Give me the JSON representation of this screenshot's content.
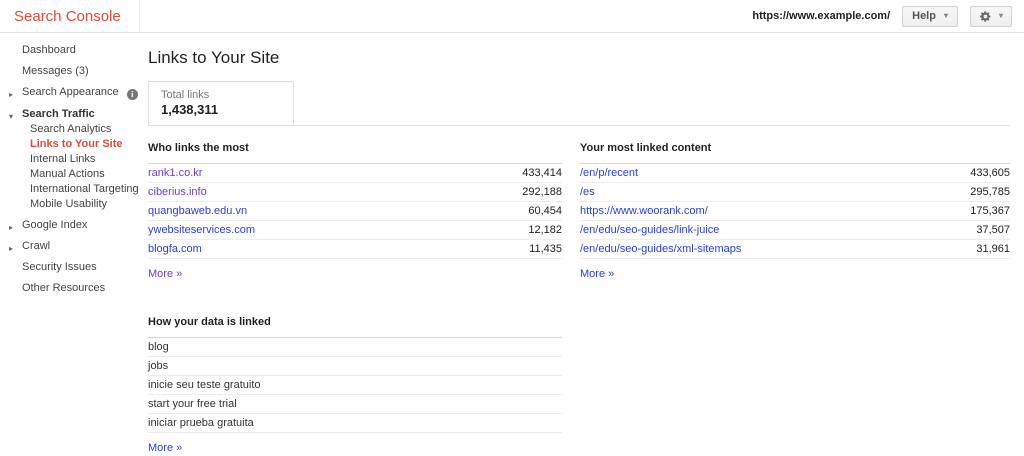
{
  "header": {
    "logo": "Search Console",
    "site_url": "https://www.example.com/",
    "help_label": "Help"
  },
  "icons": {
    "dropdown": "▾",
    "collapsed": "▸",
    "expanded": "▾",
    "info": "i"
  },
  "sidebar": {
    "items": [
      {
        "label": "Dashboard"
      },
      {
        "label": "Messages (3)"
      },
      {
        "label": "Search Appearance",
        "state": "collapsed",
        "has_info": true
      },
      {
        "label": "Search Traffic",
        "state": "expanded"
      },
      {
        "label": "Search Analytics",
        "level": "sub"
      },
      {
        "label": "Links to Your Site",
        "level": "sub",
        "selected": true
      },
      {
        "label": "Internal Links",
        "level": "sub"
      },
      {
        "label": "Manual Actions",
        "level": "sub"
      },
      {
        "label": "International Targeting",
        "level": "sub"
      },
      {
        "label": "Mobile Usability",
        "level": "sub"
      },
      {
        "label": "Google Index",
        "state": "collapsed"
      },
      {
        "label": "Crawl",
        "state": "collapsed"
      },
      {
        "label": "Security Issues"
      },
      {
        "label": "Other Resources"
      }
    ]
  },
  "main": {
    "title": "Links to Your Site",
    "total_links": {
      "label": "Total links",
      "value": "1,438,311"
    },
    "tables": {
      "who_links": {
        "header": "Who links the most",
        "rows": [
          {
            "link": "rank1.co.kr",
            "value": "433,414",
            "visited": true
          },
          {
            "link": "ciberius.info",
            "value": "292,188",
            "visited": true
          },
          {
            "link": "quangbaweb.edu.vn",
            "value": "60,454",
            "visited": false
          },
          {
            "link": "ywebsiteservices.com",
            "value": "12,182",
            "visited": false
          },
          {
            "link": "blogfa.com",
            "value": "11,435",
            "visited": false
          }
        ],
        "more_label": "More »"
      },
      "linked_content": {
        "header": "Your most linked content",
        "rows": [
          {
            "link": "/en/p/recent",
            "value": "433,605",
            "visited": false
          },
          {
            "link": "/es",
            "value": "295,785",
            "visited": false
          },
          {
            "link": "https://www.woorank.com/",
            "value": "175,367",
            "visited": false
          },
          {
            "link": "/en/edu/seo-guides/link-juice",
            "value": "37,507",
            "visited": false
          },
          {
            "link": "/en/edu/seo-guides/xml-sitemaps",
            "value": "31,961",
            "visited": false
          }
        ],
        "more_label": "More »"
      },
      "data_linked": {
        "header": "How your data is linked",
        "rows": [
          {
            "text": "blog"
          },
          {
            "text": "jobs"
          },
          {
            "text": "inicie seu teste gratuito"
          },
          {
            "text": "start your free trial"
          },
          {
            "text": "iniciar prueba gratuita"
          }
        ],
        "more_label": "More »"
      }
    }
  },
  "colors": {
    "brand_red": "#dd4b39",
    "link_blue": "#2a41cf",
    "visited_purple": "#6e3cc4"
  }
}
